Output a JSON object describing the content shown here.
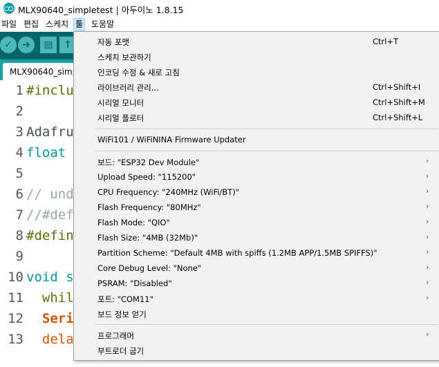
{
  "window": {
    "title": "MLX90640_simpletest | 아두이노 1.8.15",
    "app_icon": "arduino-logo-icon"
  },
  "menubar": {
    "items": [
      {
        "label": "파일"
      },
      {
        "label": "편집"
      },
      {
        "label": "스케치"
      },
      {
        "label": "툴",
        "active": true
      },
      {
        "label": "도움말"
      }
    ]
  },
  "toolbar": {
    "buttons": [
      {
        "icon": "verify-check-icon",
        "glyph": "✓"
      },
      {
        "icon": "upload-arrow-icon",
        "glyph": "➜"
      },
      {
        "icon": "new-file-icon",
        "glyph": "▤"
      },
      {
        "icon": "open-up-arrow-icon",
        "glyph": "↑"
      }
    ]
  },
  "tab": {
    "label": "MLX90640_simp"
  },
  "editor": {
    "lines": [
      {
        "num": "1",
        "text": "#inclu"
      },
      {
        "num": "2",
        "text": ""
      },
      {
        "num": "3",
        "text": "Adafru"
      },
      {
        "num": "4",
        "text": "float"
      },
      {
        "num": "5",
        "text": ""
      },
      {
        "num": "6",
        "text": "// und"
      },
      {
        "num": "7",
        "text": "//#def"
      },
      {
        "num": "8",
        "text": "#defin"
      },
      {
        "num": "9",
        "text": ""
      },
      {
        "num": "10",
        "text": "void s"
      },
      {
        "num": "11",
        "text": "  whil"
      },
      {
        "num": "12",
        "text": "  Seri"
      },
      {
        "num": "13",
        "text": "  dela"
      }
    ],
    "edge_glyph": "o"
  },
  "dropdown": {
    "items": [
      {
        "label": "자동 포맷",
        "shortcut": "Ctrl+T"
      },
      {
        "label": "스케치 보관하기",
        "shortcut": ""
      },
      {
        "label": "인코딩 수정 & 새로 고침",
        "shortcut": ""
      },
      {
        "label": "라이브러리 관리...",
        "shortcut": "Ctrl+Shift+I"
      },
      {
        "label": "시리얼 모니터",
        "shortcut": "Ctrl+Shift+M"
      },
      {
        "label": "시리얼 플로터",
        "shortcut": "Ctrl+Shift+L"
      },
      {
        "label": "WiFi101 / WiFiNINA Firmware Updater",
        "shortcut": ""
      },
      {
        "label": "보드: \"ESP32 Dev Module\"",
        "submenu": true
      },
      {
        "label": "Upload Speed: \"115200\"",
        "submenu": true
      },
      {
        "label": "CPU Frequency: \"240MHz (WiFi/BT)\"",
        "submenu": true
      },
      {
        "label": "Flash Frequency: \"80MHz\"",
        "submenu": true
      },
      {
        "label": "Flash Mode: \"QIO\"",
        "submenu": true
      },
      {
        "label": "Flash Size: \"4MB (32Mb)\"",
        "submenu": true
      },
      {
        "label": "Partition Scheme: \"Default 4MB with spiffs (1.2MB APP/1.5MB SPIFFS)\"",
        "submenu": true
      },
      {
        "label": "Core Debug Level: \"None\"",
        "submenu": true
      },
      {
        "label": "PSRAM: \"Disabled\"",
        "submenu": true
      },
      {
        "label": "포트: \"COM11\"",
        "submenu": true
      },
      {
        "label": "보드 정보 얻기",
        "submenu": false
      },
      {
        "label": "프로그래머",
        "submenu": true
      },
      {
        "label": "부트로더 굽기",
        "submenu": false
      }
    ],
    "submenu_arrow": "›"
  },
  "colors": {
    "toolbar_bg": "#006468",
    "tabbar_bg": "#17a1a5",
    "button_fill": "#4db7bb",
    "menu_bg": "#f2f2f2",
    "active_menu_highlight": "#cce8ff"
  }
}
